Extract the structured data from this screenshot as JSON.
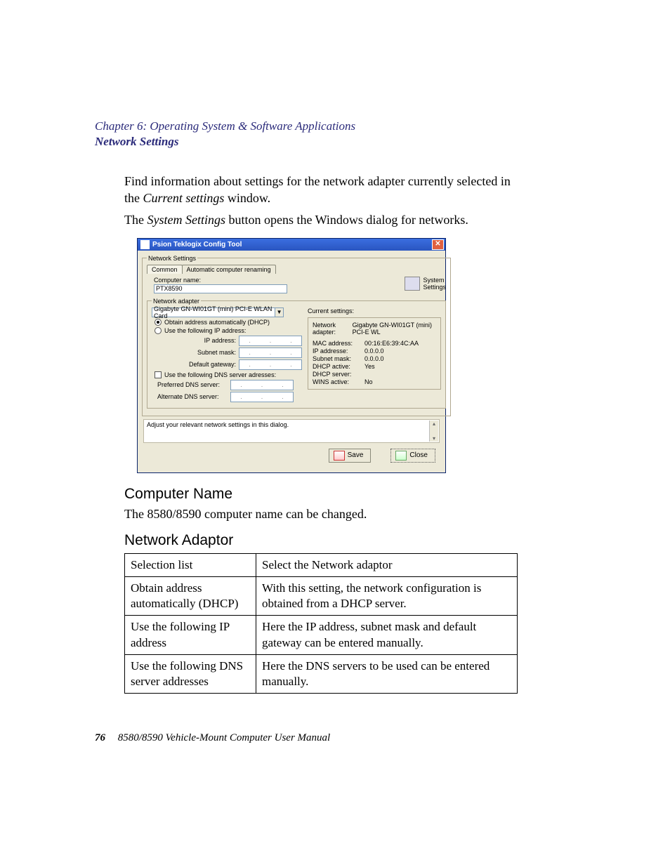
{
  "header": {
    "chapter": "Chapter  6:  Operating System & Software Applications",
    "section": "Network Settings"
  },
  "intro": {
    "p1a": "Find information about settings for the network adapter currently selected in the ",
    "p1b": "Current settings",
    "p1c": " window.",
    "p2a": "The ",
    "p2b": "System Settings",
    "p2c": " button opens the Windows dialog for networks."
  },
  "dialog": {
    "title": "Psion Teklogix Config Tool",
    "fieldset": "Network Settings",
    "tabs": {
      "common": "Common",
      "auto": "Automatic computer renaming"
    },
    "computer_name_label": "Computer name:",
    "computer_name_value": "PTX8590",
    "system_settings": "System\nSettings",
    "adapter_legend": "Network adapter",
    "adapter_value": "Gigabyte GN-WI01GT (mini) PCI-E WLAN Card",
    "radio_dhcp": "Obtain address automatically (DHCP)",
    "radio_static": "Use the following IP address:",
    "ip_label": "IP address:",
    "subnet_label": "Subnet mask:",
    "gateway_label": "Default gateway:",
    "dns_check": "Use the following DNS server adresses:",
    "dns_pref": "Preferred DNS server:",
    "dns_alt": "Alternate DNS server:",
    "current_hdr": "Current settings:",
    "info": {
      "net_adapter_k": "Network adapter:",
      "net_adapter_v": "Gigabyte GN-WI01GT (mini) PCI-E WL",
      "mac_k": "MAC address:",
      "mac_v": "00:16:E6:39:4C:AA",
      "ip_k": "IP addresse:",
      "ip_v": "0.0.0.0",
      "sub_k": "Subnet mask:",
      "sub_v": "0.0.0.0",
      "dhcp_k": "DHCP active:",
      "dhcp_v": "Yes",
      "dhcps_k": "DHCP server:",
      "dhcps_v": "",
      "wins_k": "WINS active:",
      "wins_v": "No"
    },
    "status_msg": "Adjust your relevant network settings in this dialog.",
    "save_btn": "Save",
    "close_btn": "Close"
  },
  "sections": {
    "computer_name_h": "Computer Name",
    "computer_name_p": "The 8580/8590 computer name can be changed.",
    "network_adaptor_h": "Network Adaptor"
  },
  "table": {
    "r1c1": "Selection list",
    "r1c2": "Select the Network adaptor",
    "r2c1": "Obtain address automatically (DHCP)",
    "r2c2": "With this setting, the network configuration is obtained from a DHCP server.",
    "r3c1": "Use the following IP address",
    "r3c2": "Here the IP address, subnet mask and default gateway can be entered manually.",
    "r4c1": "Use the following DNS server addresses",
    "r4c2": "Here the DNS servers to be used can be entered manually."
  },
  "footer": {
    "page": "76",
    "title": "8580/8590 Vehicle-Mount Computer User Manual"
  }
}
